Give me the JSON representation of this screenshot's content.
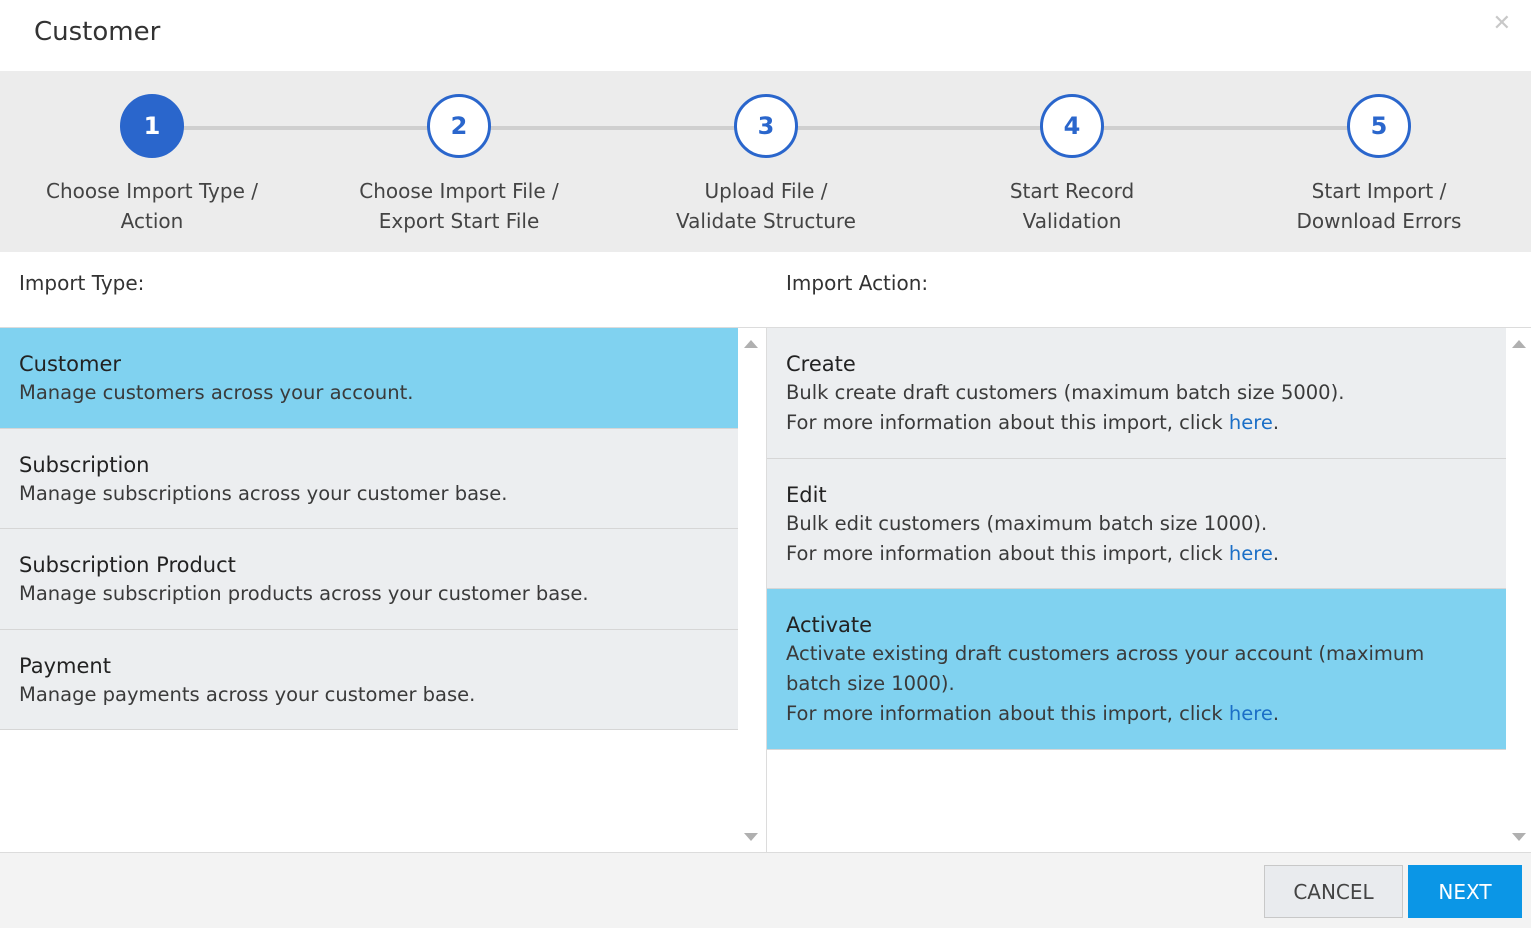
{
  "dialog": {
    "title": "Customer"
  },
  "steps": [
    {
      "number": "1",
      "line1": "Choose Import Type /",
      "line2": "Action",
      "active": true
    },
    {
      "number": "2",
      "line1": "Choose Import File /",
      "line2": "Export Start File",
      "active": false
    },
    {
      "number": "3",
      "line1": "Upload File /",
      "line2": "Validate Structure",
      "active": false
    },
    {
      "number": "4",
      "line1": "Start Record",
      "line2": "Validation",
      "active": false
    },
    {
      "number": "5",
      "line1": "Start Import /",
      "line2": "Download Errors",
      "active": false
    }
  ],
  "import_type": {
    "label": "Import Type:",
    "items": [
      {
        "title": "Customer",
        "desc": "Manage customers across your account.",
        "selected": true
      },
      {
        "title": "Subscription",
        "desc": "Manage subscriptions across your customer base.",
        "selected": false
      },
      {
        "title": "Subscription Product",
        "desc": "Manage subscription products across your customer base.",
        "selected": false
      },
      {
        "title": "Payment",
        "desc": "Manage payments across your customer base.",
        "selected": false
      }
    ]
  },
  "import_action": {
    "label": "Import Action:",
    "more_info_prefix": "For more information about this import, click ",
    "link_text": "here",
    "suffix": ".",
    "items": [
      {
        "title": "Create",
        "desc": "Bulk create draft customers (maximum batch size 5000).",
        "selected": false
      },
      {
        "title": "Edit",
        "desc": "Bulk edit customers (maximum batch size 1000).",
        "selected": false
      },
      {
        "title": "Activate",
        "desc": "Activate existing draft customers across your account (maximum batch size 1000).",
        "selected": true
      }
    ]
  },
  "footer": {
    "cancel_label": "CANCEL",
    "next_label": "NEXT"
  },
  "colors": {
    "accent": "#2a66cc",
    "selected_row": "#80d2f0",
    "next_button": "#0b96e6",
    "link": "#1b6fc7"
  }
}
